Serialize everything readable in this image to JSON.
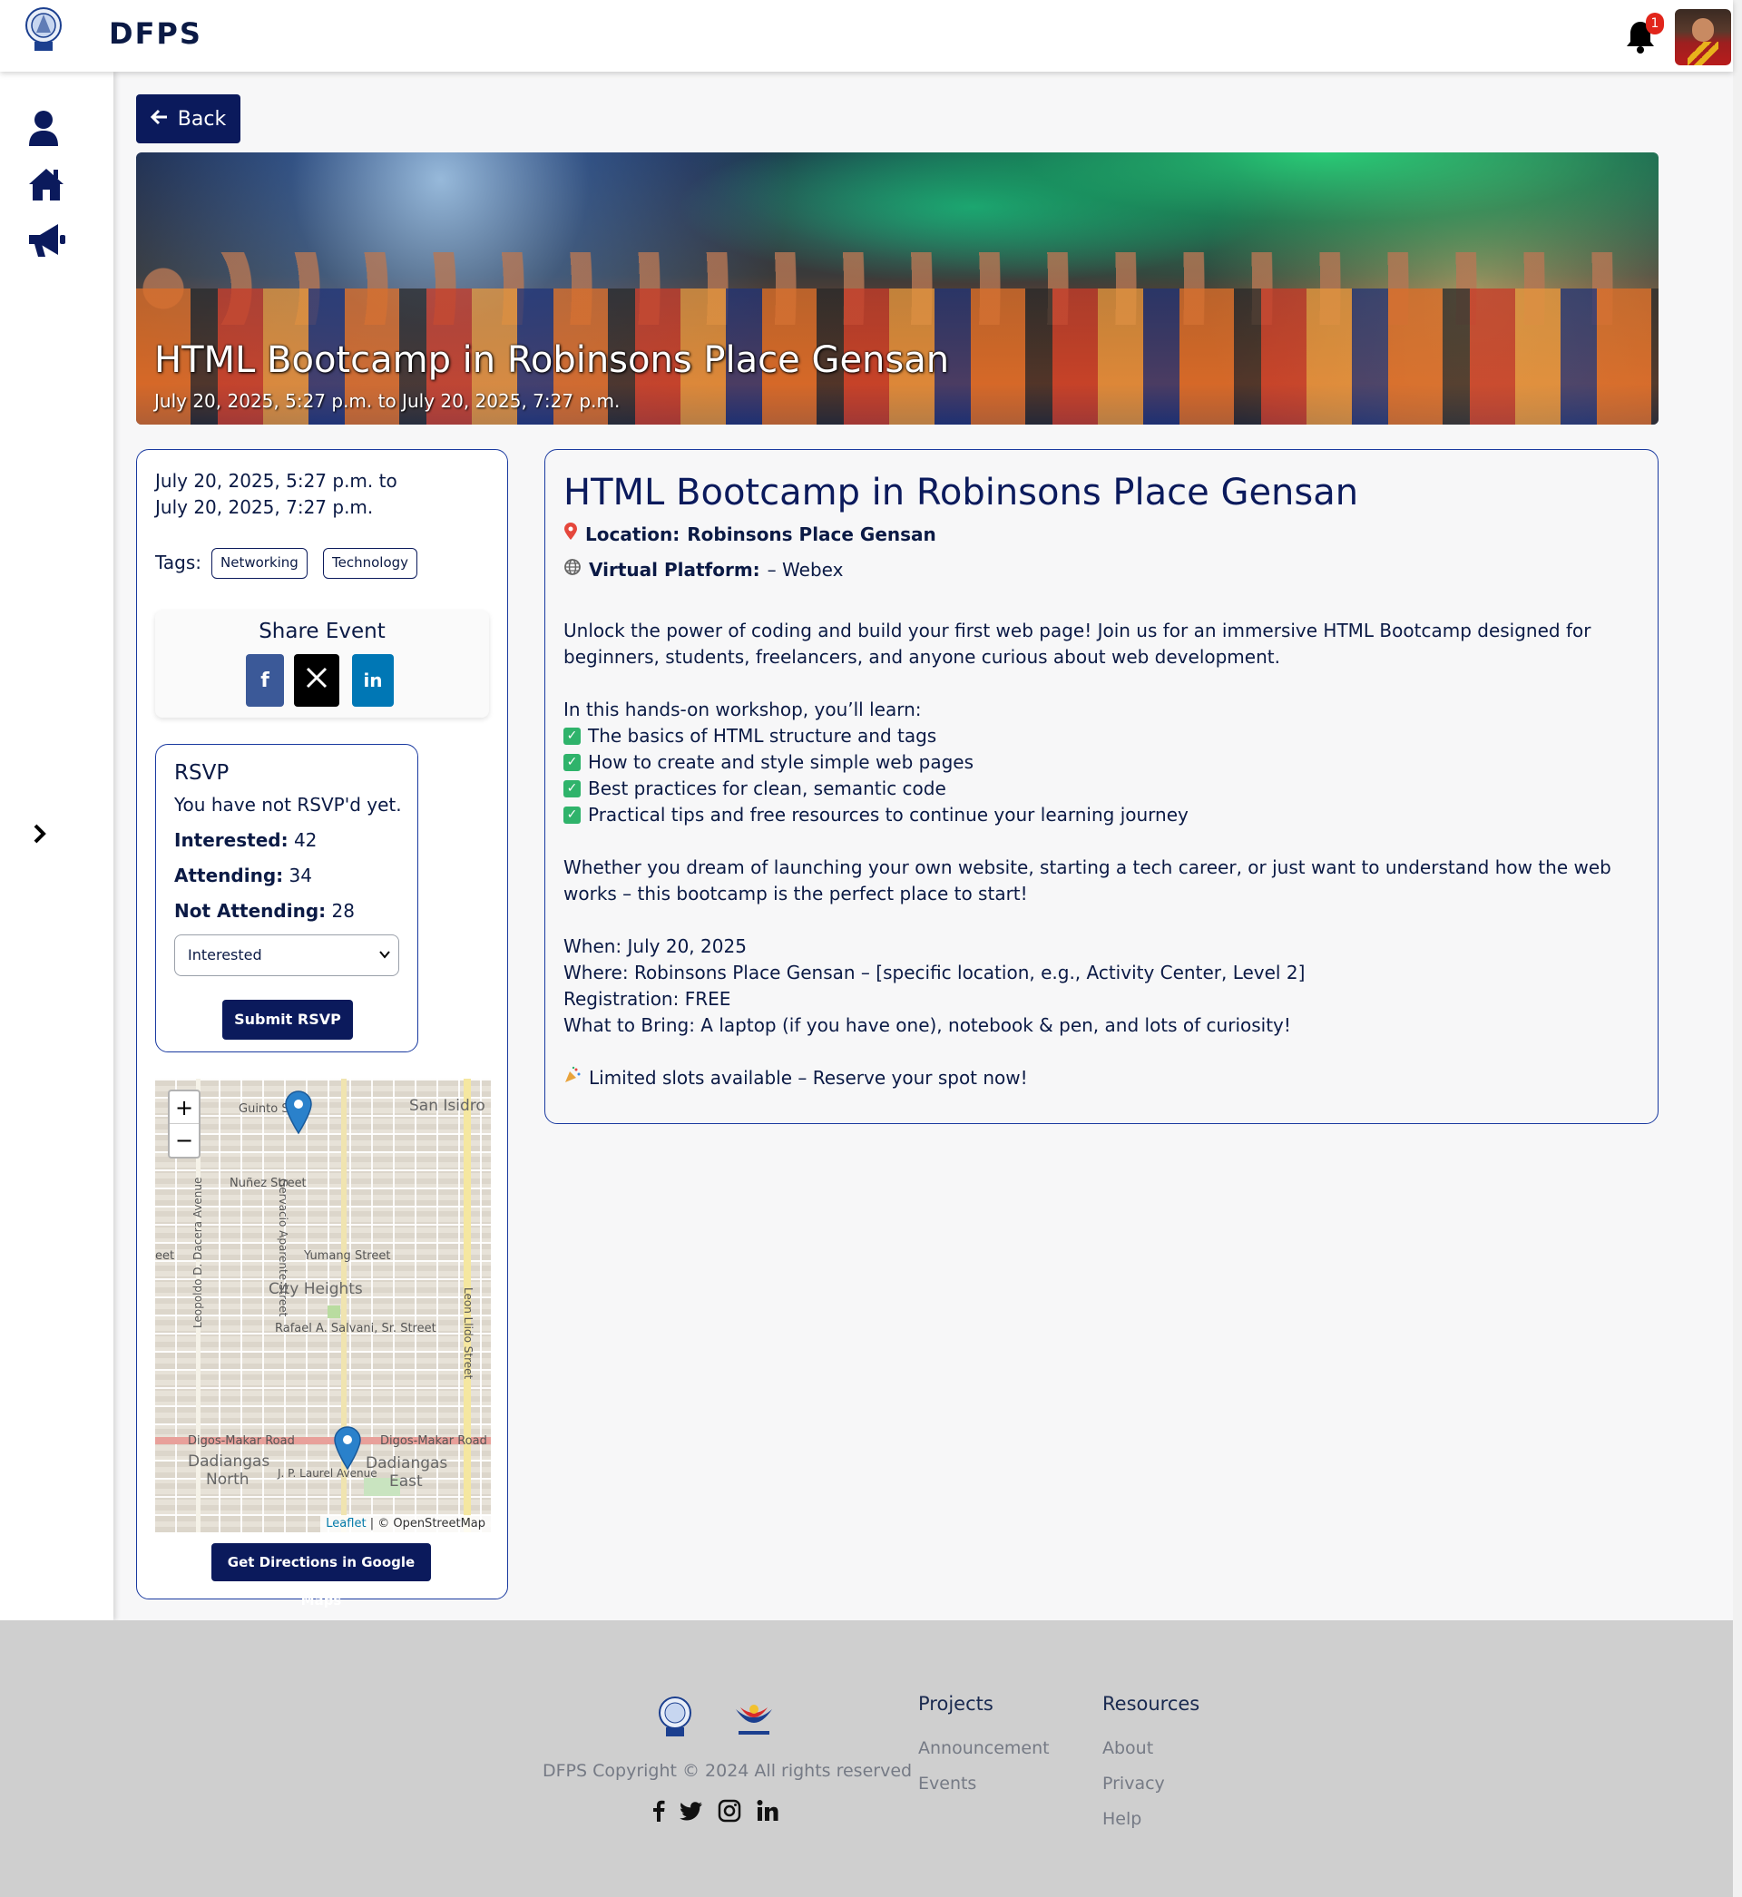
{
  "app": {
    "brand": "DFPS",
    "notifications_count": "1"
  },
  "nav": {
    "back_label": "Back"
  },
  "hero": {
    "title": "HTML Bootcamp in Robinsons Place Gensan",
    "subtitle": "July 20, 2025, 5:27 p.m. to July 20, 2025, 7:27 p.m."
  },
  "event": {
    "date_line1": "July 20, 2025, 5:27 p.m. to",
    "date_line2": "July 20, 2025, 7:27 p.m.",
    "tags_label": "Tags:",
    "tags": [
      "Networking",
      "Technology"
    ],
    "share_title": "Share Event",
    "title": "HTML Bootcamp in Robinsons Place Gensan",
    "location_label": "Location:",
    "location_value": "Robinsons Place Gensan",
    "platform_label": "Virtual Platform:",
    "platform_value": "–  Webex",
    "description": {
      "intro": "Unlock the power of coding and build your first web page! Join us for an immersive HTML Bootcamp designed for beginners, students, freelancers, and anyone curious about web development.",
      "learn_heading": "In this hands-on workshop, you’ll learn:",
      "learn_items": [
        "The basics of HTML structure and tags",
        "How to create and style simple web pages",
        "Best practices for clean, semantic code",
        "Practical tips and free resources to continue your learning journey"
      ],
      "closing": "Whether you dream of launching your own website, starting a tech career, or just want to understand how the web works – this bootcamp is the perfect place to start!",
      "when": "When: July 20, 2025",
      "where": "Where: Robinsons Place Gensan – [specific location, e.g., Activity Center, Level 2]",
      "registration": "Registration: FREE",
      "bring": "What to Bring: A laptop (if you have one), notebook & pen, and lots of curiosity!",
      "cta": "Limited slots available – Reserve your spot now!"
    }
  },
  "rsvp": {
    "title": "RSVP",
    "status": "You have not RSVP'd yet.",
    "interested_label": "Interested:",
    "interested_count": "42",
    "attending_label": "Attending:",
    "attending_count": "34",
    "not_attending_label": "Not Attending:",
    "not_attending_count": "28",
    "selected_option": "Interested",
    "submit_label": "Submit RSVP"
  },
  "map": {
    "zoom_in": "+",
    "zoom_out": "−",
    "labels": {
      "guinto": "Guinto St",
      "san_isidro": "San Isidro",
      "nunez": "Nuñez Street",
      "gervacio": "Gervacio Aparente Street",
      "leopoldo": "Leopoldo D. Dacera Avenue",
      "yumang": "Yumang Street",
      "city_heights": "City Heights",
      "rafael": "Rafael A. Salvani, Sr. Street",
      "leon_llido": "Leon Llido Street",
      "digos1": "Digos-Makar Road",
      "digos2": "Digos-Makar Road",
      "dadiangas_north1": "Dadiangas",
      "dadiangas_north2": "North",
      "dadiangas_east1": "Dadiangas",
      "dadiangas_east2": "East",
      "jp_laurel": "J. P. Laurel Avenue",
      "eet": "eet"
    },
    "attribution_leaflet": "Leaflet",
    "attribution_rest": " | © OpenStreetMap",
    "directions_label": "Get Directions in Google Maps"
  },
  "footer": {
    "copyright": "DFPS Copyright © 2024 All rights reserved",
    "projects_title": "Projects",
    "projects_links": [
      "Announcement",
      "Events"
    ],
    "resources_title": "Resources",
    "resources_links": [
      "About",
      "Privacy",
      "Help"
    ]
  },
  "colors": {
    "navy": "#0b1a5c",
    "accent_border": "#1a3aa0",
    "badge": "#e1251b",
    "facebook": "#3b5998",
    "twitter": "#000000",
    "linkedin": "#0077b5",
    "check": "#2fb36b"
  },
  "icons": [
    "user-icon",
    "home-icon",
    "megaphone-icon",
    "chevron-right-icon",
    "bell-icon",
    "arrow-left-icon",
    "location-pin-icon",
    "globe-icon",
    "check-icon",
    "party-popper-icon",
    "facebook-icon",
    "x-icon",
    "linkedin-icon",
    "twitter-icon",
    "instagram-icon"
  ]
}
